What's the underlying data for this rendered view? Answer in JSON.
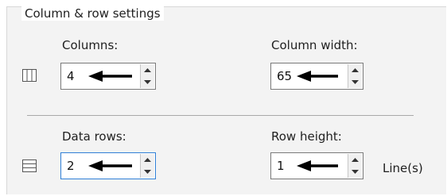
{
  "group": {
    "title": "Column & row settings"
  },
  "columns": {
    "label": "Columns:",
    "value": "4",
    "icon": "columns-icon"
  },
  "column_width": {
    "label": "Column width:",
    "value": "65"
  },
  "data_rows": {
    "label": "Data rows:",
    "value": "2",
    "icon": "rows-icon"
  },
  "row_height": {
    "label": "Row height:",
    "value": "1",
    "unit": "Line(s)"
  },
  "annotations": {
    "arrow_color": "#000000"
  }
}
